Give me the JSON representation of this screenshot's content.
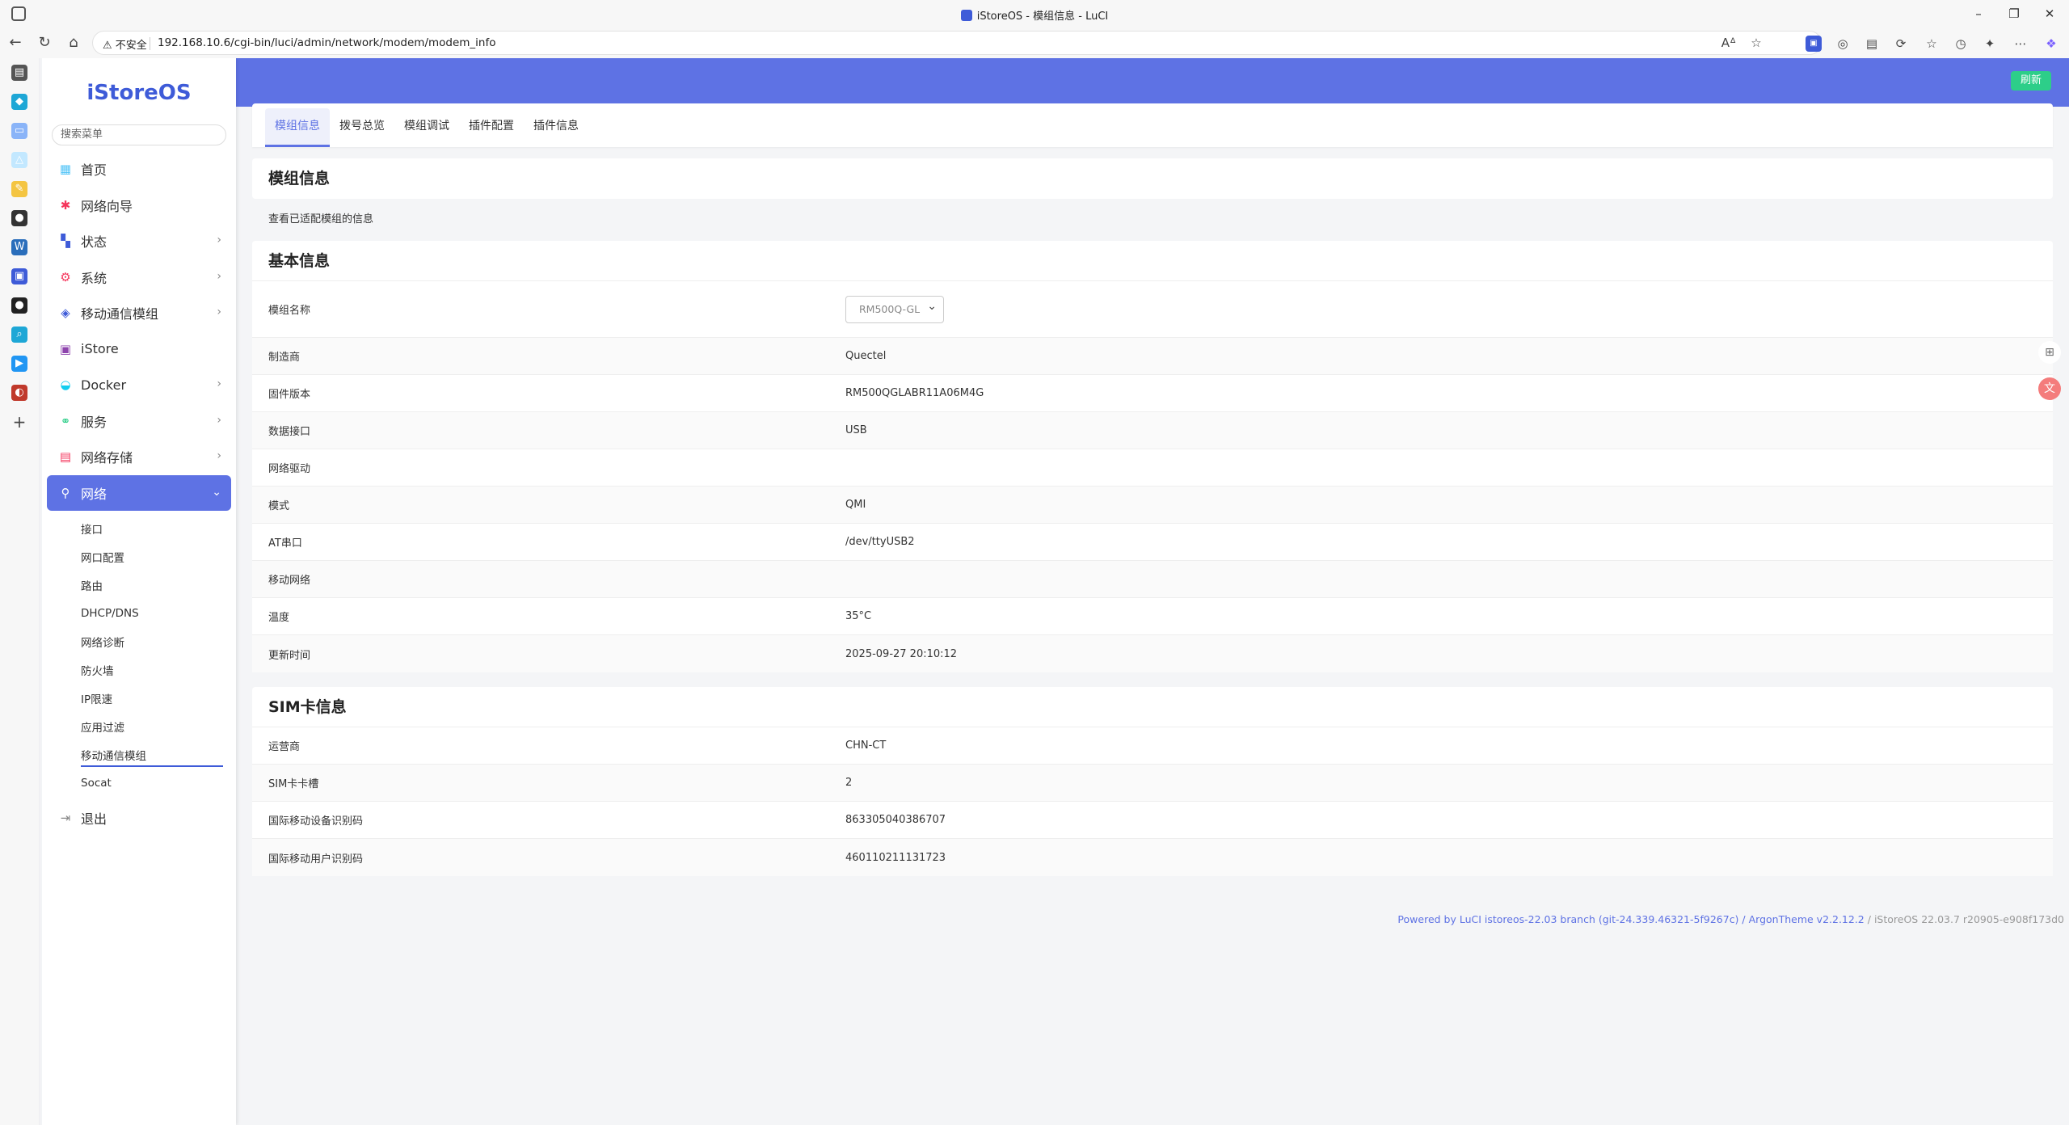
{
  "window": {
    "title": "iStoreOS - 模组信息 - LuCI"
  },
  "address": {
    "security": "不安全",
    "url": "192.168.10.6/cgi-bin/luci/admin/network/modem/modem_info"
  },
  "brand": {
    "logo": "iStoreOS",
    "accent": "#5e72e4"
  },
  "sidebar": {
    "search_placeholder": "搜索菜单",
    "items": [
      {
        "label": "首页",
        "icon": "home-icon",
        "color": "#4fc3f7"
      },
      {
        "label": "网络向导",
        "icon": "wizard-icon",
        "color": "#f5365c"
      },
      {
        "label": "状态",
        "icon": "dashboard-icon",
        "color": "#3e5bd8"
      },
      {
        "label": "系统",
        "icon": "gear-icon",
        "color": "#f5365c"
      },
      {
        "label": "移动通信模组",
        "icon": "cube-icon",
        "color": "#3e5bd8"
      },
      {
        "label": "iStore",
        "icon": "bag-icon",
        "color": "#8e44ad"
      },
      {
        "label": "Docker",
        "icon": "docker-icon",
        "color": "#11cdef"
      },
      {
        "label": "服务",
        "icon": "services-icon",
        "color": "#2dce89"
      },
      {
        "label": "网络存储",
        "icon": "storage-icon",
        "color": "#f5365c"
      },
      {
        "label": "网络",
        "icon": "network-icon"
      }
    ],
    "submenu": [
      "接口",
      "网口配置",
      "路由",
      "DHCP/DNS",
      "网络诊断",
      "防火墙",
      "IP限速",
      "应用过滤",
      "移动通信模组",
      "Socat"
    ],
    "logout": "退出"
  },
  "header": {
    "refresh_label": "刷新"
  },
  "tabs": [
    "模组信息",
    "拨号总览",
    "模组调试",
    "插件配置",
    "插件信息"
  ],
  "module_card": {
    "title": "模组信息",
    "description": "查看已适配模组的信息"
  },
  "basic": {
    "title": "基本信息",
    "model_label": "模组名称",
    "model_value": "RM500Q-GL",
    "rows": [
      {
        "k": "制造商",
        "v": "Quectel"
      },
      {
        "k": "固件版本",
        "v": "RM500QGLABR11A06M4G"
      },
      {
        "k": "数据接口",
        "v": "USB"
      },
      {
        "k": "网络驱动",
        "v": ""
      },
      {
        "k": "模式",
        "v": "QMI"
      },
      {
        "k": "AT串口",
        "v": "/dev/ttyUSB2"
      },
      {
        "k": "移动网络",
        "v": ""
      },
      {
        "k": "温度",
        "v": "35°C"
      },
      {
        "k": "更新时间",
        "v": "2025-09-27 20:10:12"
      }
    ]
  },
  "sim": {
    "title": "SIM卡信息",
    "rows": [
      {
        "k": "运营商",
        "v": "CHN-CT"
      },
      {
        "k": "SIM卡卡槽",
        "v": "2"
      },
      {
        "k": "国际移动设备识别码",
        "v": "863305040386707"
      },
      {
        "k": "国际移动用户识别码",
        "v": "460110211131723"
      }
    ]
  },
  "footer": {
    "powered": "Powered by LuCI istoreos-22.03 branch (git-24.339.46321-5f9267c)",
    "theme": "ArgonTheme v2.2.12.2",
    "version": "iStoreOS 22.03.7 r20905-e908f173d0"
  }
}
